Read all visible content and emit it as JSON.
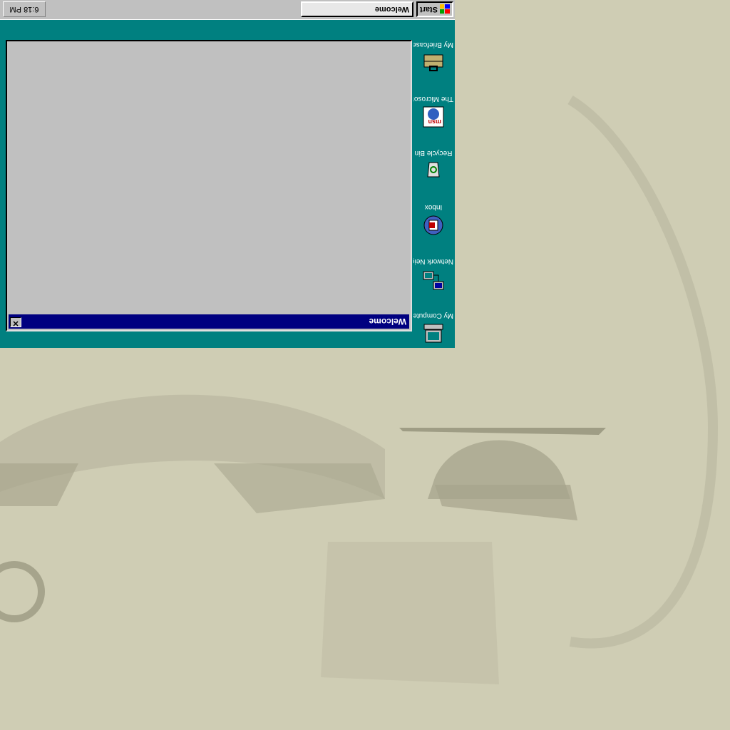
{
  "taskbar": {
    "start_label": "Start",
    "task_label": "Welcome",
    "clock": "6:18 PM"
  },
  "window": {
    "title": "Welcome",
    "close_glyph": "✕"
  },
  "desktop_icons": [
    {
      "label": "My Computer",
      "icon": "my-computer-icon"
    },
    {
      "label": "Network Neighborhood",
      "icon": "network-neighborhood-icon"
    },
    {
      "label": "Inbox",
      "icon": "inbox-icon"
    },
    {
      "label": "Recycle Bin",
      "icon": "recycle-bin-icon"
    },
    {
      "label": "The Microsoft Network",
      "icon": "msn-icon"
    },
    {
      "label": "My Briefcase",
      "icon": "briefcase-icon"
    }
  ],
  "colors": {
    "desktop": "#008080",
    "titlebar": "#000080",
    "face": "#c0c0c0",
    "texture": "#cfcdb4"
  }
}
